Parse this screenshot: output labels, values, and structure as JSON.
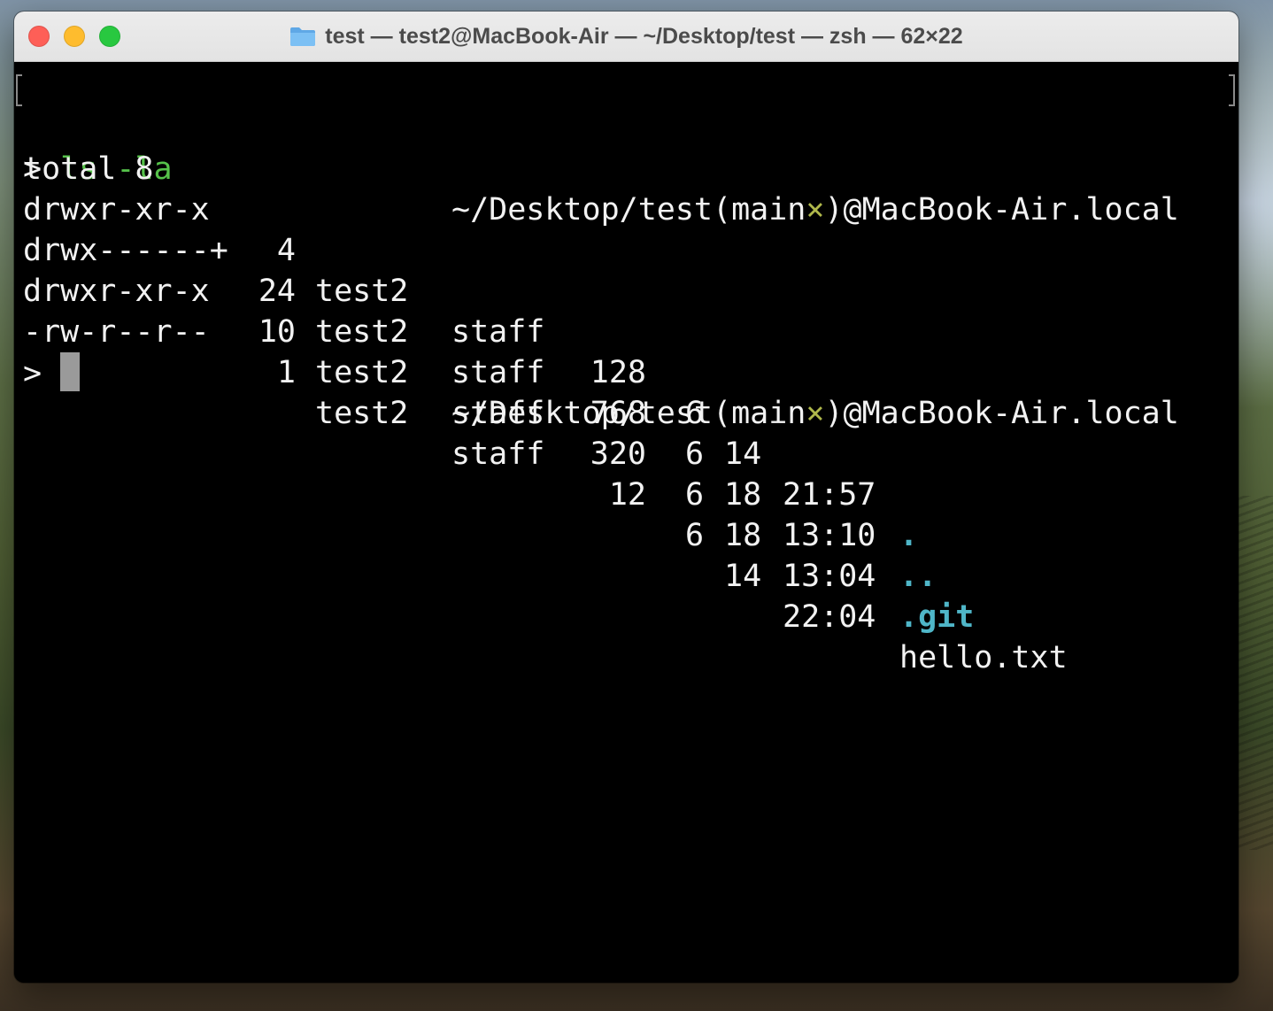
{
  "window": {
    "title": "test — test2@MacBook-Air — ~/Desktop/test — zsh — 62×22"
  },
  "prompt": {
    "symbol": ">",
    "command": "ls -la",
    "path_before": "~/Desktop/test(main",
    "git_dirty_mark": "×",
    "path_after": ")@MacBook-Air.local"
  },
  "output": {
    "total": "total 8",
    "rows": [
      {
        "perm": "drwxr-xr-x",
        "links": "4",
        "owner": "test2",
        "group": "staff",
        "size": "128",
        "month": "6",
        "day": "14",
        "time": "21:57",
        "name": "."
      },
      {
        "perm": "drwx------+",
        "links": "24",
        "owner": "test2",
        "group": "staff",
        "size": "768",
        "month": "6",
        "day": "18",
        "time": "13:10",
        "name": ".."
      },
      {
        "perm": "drwxr-xr-x",
        "links": "10",
        "owner": "test2",
        "group": "staff",
        "size": "320",
        "month": "6",
        "day": "18",
        "time": "13:04",
        "name": ".git"
      },
      {
        "perm": "-rw-r--r--",
        "links": "1",
        "owner": "test2",
        "group": "staff",
        "size": "12",
        "month": "6",
        "day": "14",
        "time": "22:04",
        "name": "hello.txt"
      }
    ]
  },
  "colors": {
    "command": "#56c24a",
    "git_mark": "#b0b84b",
    "directory": "#4fb6c8",
    "text": "#f2f2f2",
    "background": "#000000"
  }
}
